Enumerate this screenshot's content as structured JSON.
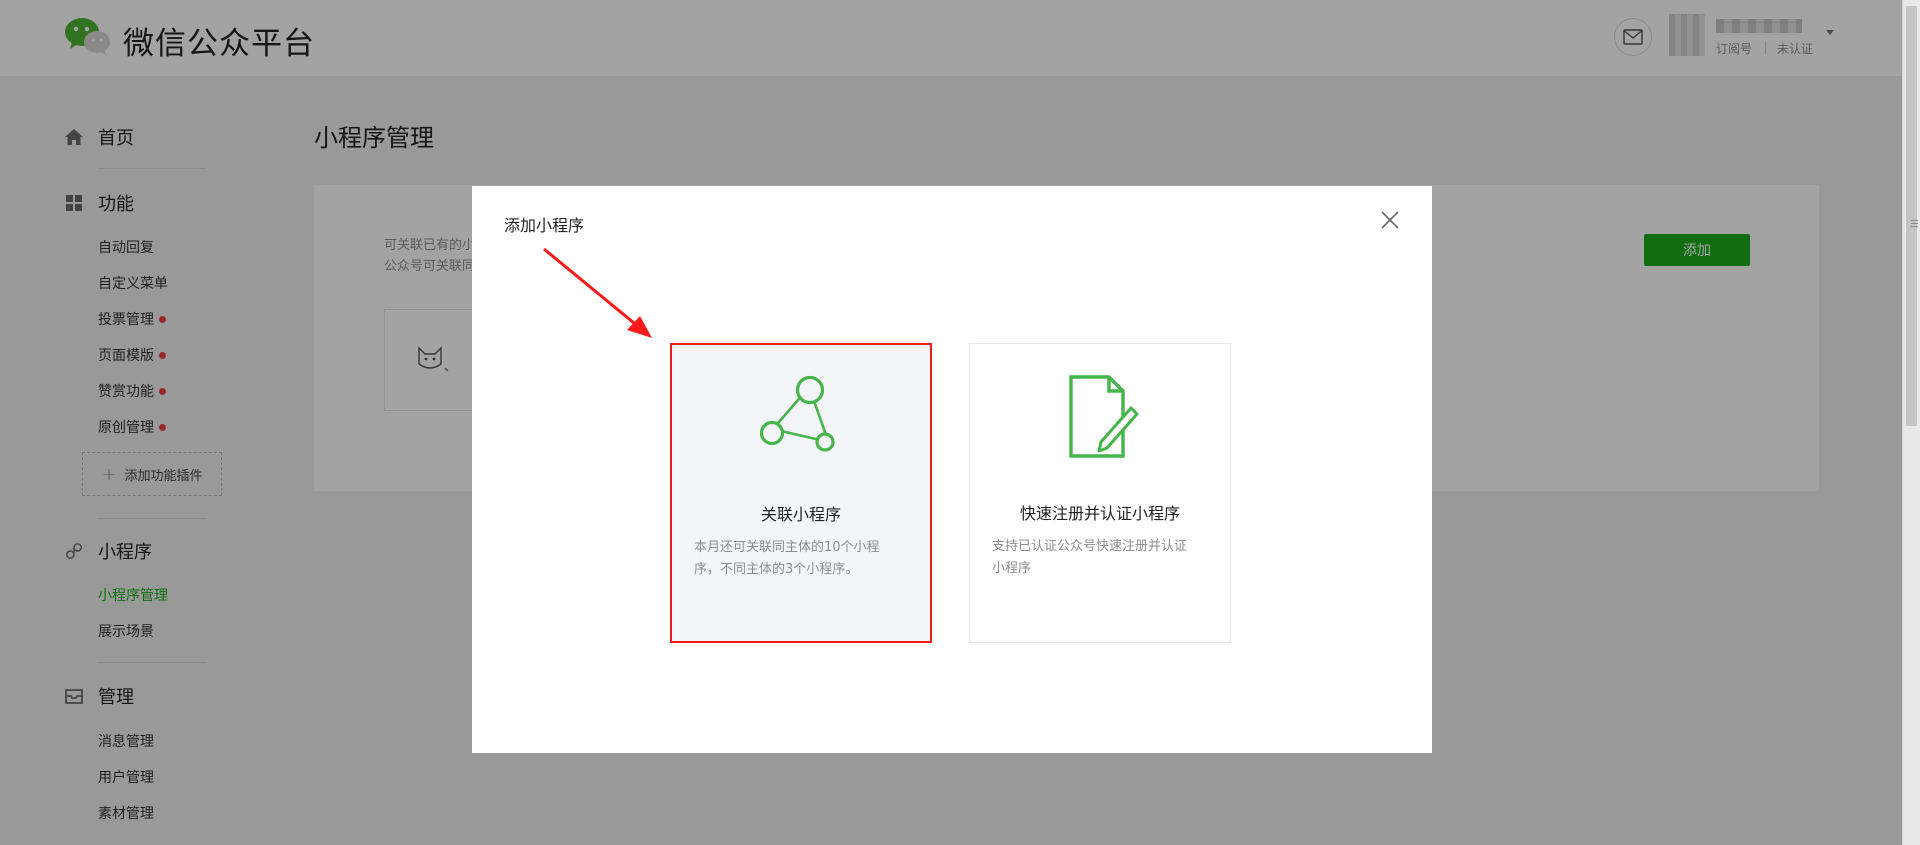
{
  "header": {
    "brand": "微信公众平台",
    "account_type": "订阅号",
    "account_status": "未认证"
  },
  "sidebar": {
    "home": "首页",
    "features": {
      "title": "功能",
      "items": [
        "自动回复",
        "自定义菜单",
        "投票管理",
        "页面模版",
        "赞赏功能",
        "原创管理"
      ],
      "add_plugin": "添加功能插件"
    },
    "miniprogram": {
      "title": "小程序",
      "items": [
        "小程序管理",
        "展示场景"
      ]
    },
    "manage": {
      "title": "管理",
      "items": [
        "消息管理",
        "用户管理",
        "素材管理"
      ]
    }
  },
  "main": {
    "page_title": "小程序管理",
    "intro_line1": "可关联已有的小",
    "intro_line2": "公众号可关联同",
    "add_button": "添加"
  },
  "modal": {
    "title": "添加小程序",
    "options": [
      {
        "title": "关联小程序",
        "desc_line1": "本月还可关联同主体的10个小程",
        "desc_line2": "序，不同主体的3个小程序。"
      },
      {
        "title": "快速注册并认证小程序",
        "desc_line1": "支持已认证公众号快速注册并认证",
        "desc_line2": "小程序"
      }
    ]
  },
  "colors": {
    "accent_green": "#1aad19",
    "notice_red": "#e64340",
    "highlight_red": "#ee1c1c"
  }
}
